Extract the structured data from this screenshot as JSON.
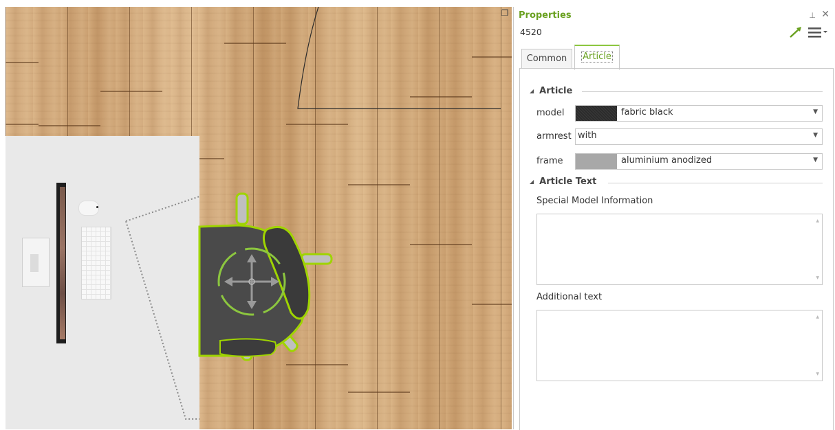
{
  "panel": {
    "title": "Properties",
    "object_id": "4520",
    "pin_glyph": "⊥",
    "close_glyph": "✕",
    "accent_color": "#6aa121"
  },
  "tabs": [
    {
      "label": "Common",
      "active": false
    },
    {
      "label": "Article",
      "active": true
    }
  ],
  "article_section": {
    "header": "Article",
    "rows": [
      {
        "label": "model",
        "value": "fabric black",
        "swatch_color": "#2b2b2b"
      },
      {
        "label": "armrest",
        "value": "with",
        "swatch_color": ""
      },
      {
        "label": "frame",
        "value": "aluminium anodized",
        "swatch_color": "#a8a8a8"
      }
    ]
  },
  "article_text_section": {
    "header": "Article Text",
    "fields": [
      {
        "label": "Special Model Information",
        "value": ""
      },
      {
        "label": "Additional text",
        "value": ""
      }
    ]
  },
  "icons": {
    "restore": "restore-window-icon",
    "wand": "magic-wand-icon",
    "menu": "hamburger-menu-icon",
    "collapse": "collapse-triangle-icon",
    "dropdown": "chevron-down-icon"
  },
  "colors": {
    "selection_outline": "#9fd400",
    "chair": "#4a4a4a",
    "floor": "#cfa577"
  }
}
